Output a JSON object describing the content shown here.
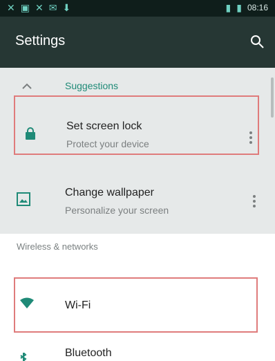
{
  "status_bar": {
    "time": "08:16",
    "left_icons": [
      "notification-x-icon",
      "image-icon",
      "notification-x-icon",
      "email-icon",
      "download-icon"
    ],
    "right_icons": [
      "signal-icon",
      "battery-icon"
    ]
  },
  "toolbar": {
    "title": "Settings",
    "search_icon": "search-icon"
  },
  "suggestions": {
    "header_label": "Suggestions",
    "items": [
      {
        "title": "Set screen lock",
        "subtitle": "Protect your device",
        "icon": "lock-icon"
      },
      {
        "title": "Change wallpaper",
        "subtitle": "Personalize your screen",
        "icon": "wallpaper-icon"
      }
    ]
  },
  "sections": [
    {
      "header": "Wireless & networks",
      "items": [
        {
          "title": "Wi-Fi",
          "icon": "wifi-icon"
        },
        {
          "title": "Bluetooth",
          "icon": "bluetooth-icon"
        }
      ]
    }
  ],
  "colors": {
    "accent": "#1f8a77",
    "toolbar": "#263734",
    "highlight_border": "#df7b7b"
  }
}
